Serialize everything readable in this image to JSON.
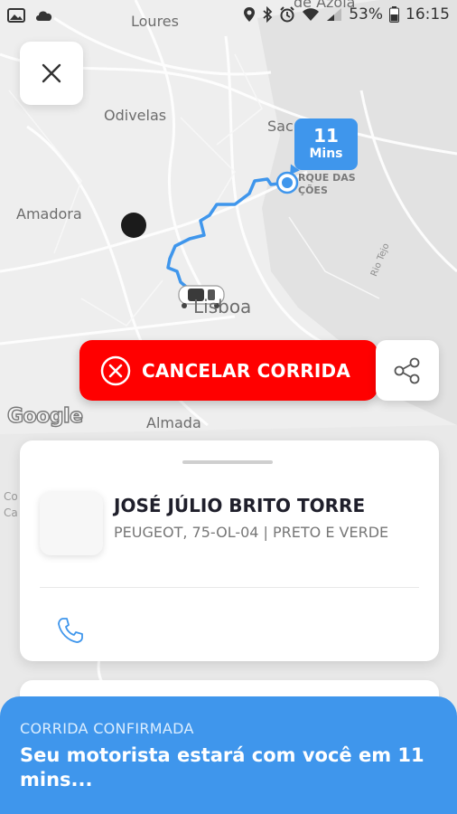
{
  "status_bar": {
    "battery": "53%",
    "time": "16:15"
  },
  "map": {
    "labels": {
      "loures": "Loures",
      "azoia": "de Azoia",
      "odivelas": "Odivelas",
      "amadora": "Amadora",
      "sac": "Sac",
      "parque_nacoes": "RQUE DAS\nÇÕES",
      "rio_tejo": "Rio Tejo",
      "lisboa": "Lisboa",
      "almada": "Almada",
      "ca": "Co\nCa"
    },
    "google_logo": "Google"
  },
  "eta": {
    "number": "11",
    "unit": "Mins"
  },
  "cancel_button": {
    "label": "CANCELAR CORRIDA"
  },
  "driver": {
    "name": "JOSÉ JÚLIO BRITO TORRE",
    "vehicle": "PEUGEOT, 75-OL-04 | PRETO E VERDE"
  },
  "banner": {
    "subtitle": "CORRIDA CONFIRMADA",
    "message": "Seu motorista estará com você em 11 mins..."
  },
  "colors": {
    "accent": "#3f96ec",
    "cancel": "#ff0000",
    "route": "#3f96ec"
  },
  "icons": [
    "image-icon",
    "cloud-icon",
    "location-icon",
    "bluetooth-icon",
    "alarm-icon",
    "wifi-icon",
    "signal-icon",
    "battery-icon",
    "close-icon",
    "cancel-x-icon",
    "share-icon",
    "phone-icon",
    "car-icon"
  ]
}
